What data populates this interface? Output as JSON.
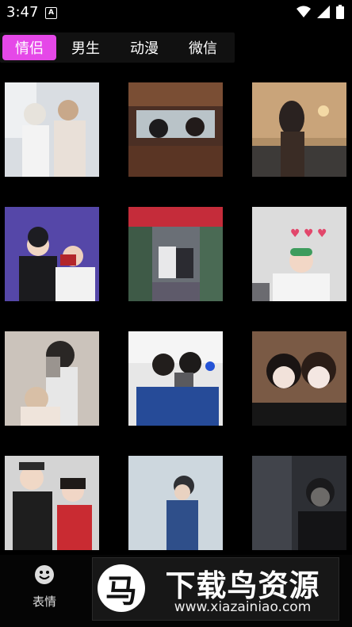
{
  "status_bar": {
    "time": "3:47",
    "app_icon_letter": "A"
  },
  "tabs": [
    {
      "label": "情侣",
      "active": true
    },
    {
      "label": "男生",
      "active": false
    },
    {
      "label": "动漫",
      "active": false
    },
    {
      "label": "微信",
      "active": false
    }
  ],
  "bottom_nav": {
    "item_label": "表情"
  },
  "watermark": {
    "logo_char": "马",
    "title": "下载鸟资源",
    "url": "www.xiazainiao.com"
  },
  "colors": {
    "accent": "#e548e8",
    "background": "#000000"
  }
}
